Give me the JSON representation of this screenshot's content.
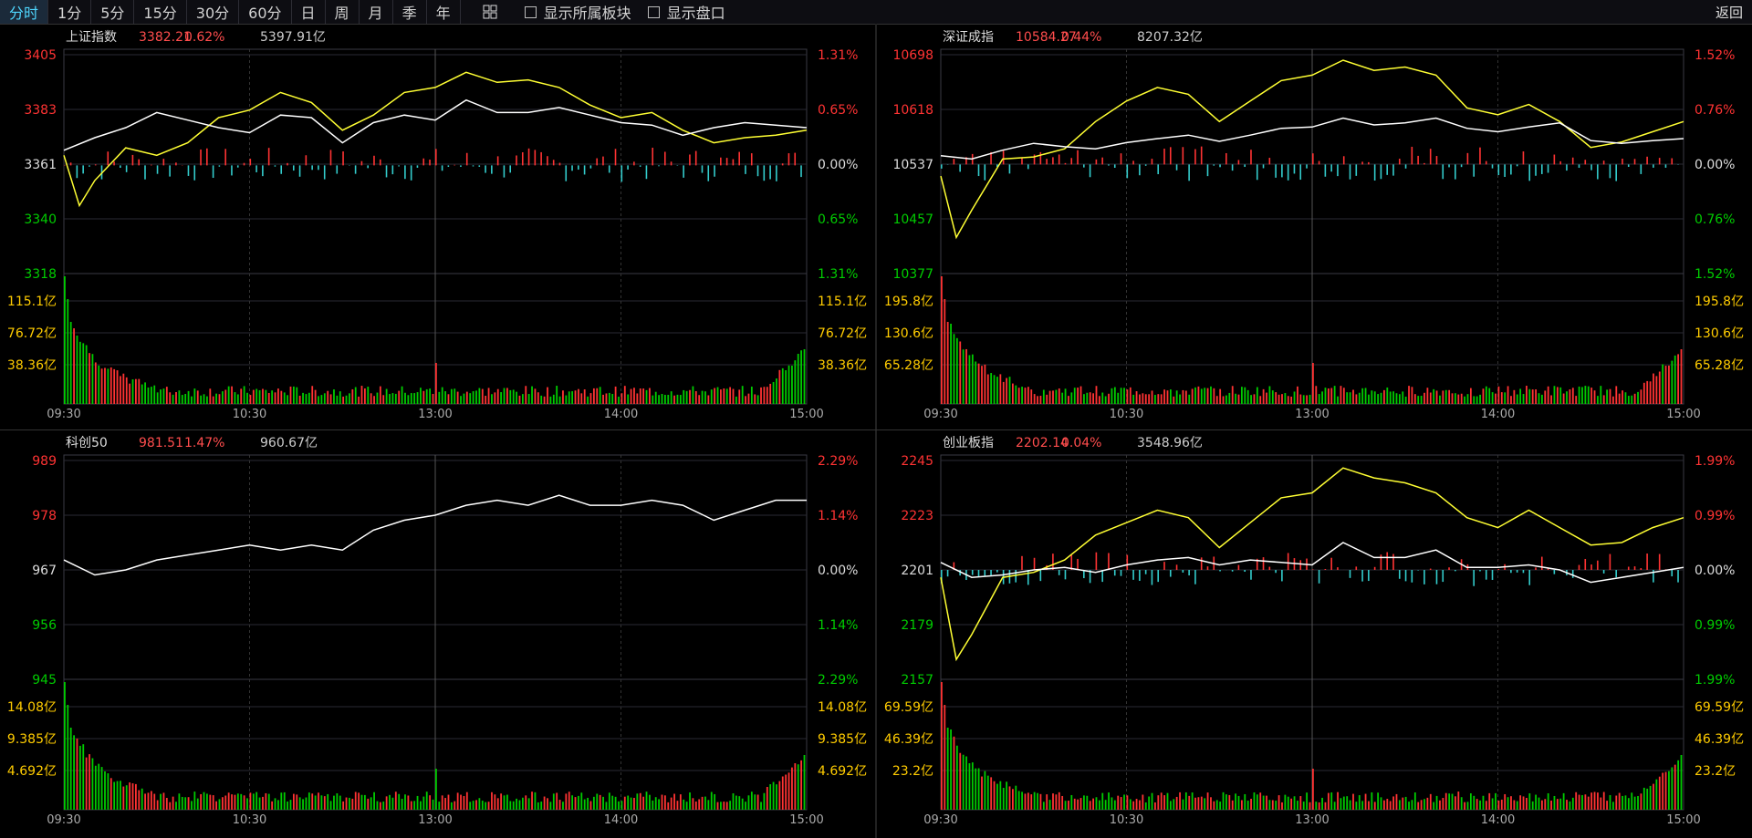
{
  "toolbar": {
    "periods": [
      "分时",
      "1分",
      "5分",
      "15分",
      "30分",
      "60分",
      "日",
      "周",
      "月",
      "季",
      "年"
    ],
    "active_period": "分时",
    "layout_icon": "grid-icon",
    "checkbox_sectors": "显示所属板块",
    "checkbox_orderbook": "显示盘口",
    "back": "返回"
  },
  "colors": {
    "up": "#ff3333",
    "down": "#00cc00",
    "white_line": "#ffffff",
    "yellow_line": "#ffff33",
    "grid": "#2a2a33",
    "vol_label": "#ffcc00",
    "neg_bar": "#33cccc"
  },
  "chart_data": [
    {
      "type": "line",
      "name": "上证指数",
      "price": "3382.21",
      "pct": "0.62%",
      "amount": "5397.91亿",
      "price_ticks": [
        "3405",
        "3383",
        "3361",
        "3340",
        "3318"
      ],
      "pct_ticks": [
        "1.31%",
        "0.65%",
        "0.00%",
        "0.65%",
        "1.31%"
      ],
      "vol_ticks": [
        "115.1亿",
        "76.72亿",
        "38.36亿"
      ],
      "time_ticks": [
        "09:30",
        "10:30",
        "13:00",
        "14:00",
        "15:00"
      ],
      "prev_close": 3361,
      "ylim": [
        3318,
        3405
      ],
      "white": [
        [
          0,
          3367
        ],
        [
          10,
          3372
        ],
        [
          20,
          3376
        ],
        [
          30,
          3382
        ],
        [
          40,
          3379
        ],
        [
          50,
          3376
        ],
        [
          60,
          3374
        ],
        [
          70,
          3381
        ],
        [
          80,
          3380
        ],
        [
          90,
          3370
        ],
        [
          100,
          3378
        ],
        [
          110,
          3381
        ],
        [
          120,
          3379
        ],
        [
          130,
          3387
        ],
        [
          140,
          3382
        ],
        [
          150,
          3382
        ],
        [
          160,
          3384
        ],
        [
          170,
          3381
        ],
        [
          180,
          3378
        ],
        [
          190,
          3377
        ],
        [
          200,
          3373
        ],
        [
          210,
          3376
        ],
        [
          220,
          3378
        ],
        [
          230,
          3377
        ],
        [
          240,
          3376
        ]
      ],
      "yellow": [
        [
          0,
          3365
        ],
        [
          5,
          3345
        ],
        [
          10,
          3355
        ],
        [
          20,
          3368
        ],
        [
          30,
          3365
        ],
        [
          40,
          3370
        ],
        [
          50,
          3380
        ],
        [
          60,
          3383
        ],
        [
          70,
          3390
        ],
        [
          80,
          3386
        ],
        [
          90,
          3375
        ],
        [
          100,
          3381
        ],
        [
          110,
          3390
        ],
        [
          120,
          3392
        ],
        [
          130,
          3398
        ],
        [
          140,
          3394
        ],
        [
          150,
          3395
        ],
        [
          160,
          3392
        ],
        [
          170,
          3385
        ],
        [
          180,
          3380
        ],
        [
          190,
          3382
        ],
        [
          200,
          3375
        ],
        [
          210,
          3370
        ],
        [
          220,
          3372
        ],
        [
          230,
          3373
        ],
        [
          240,
          3375
        ]
      ]
    },
    {
      "type": "line",
      "name": "深证成指",
      "price": "10584.27",
      "pct": "0.44%",
      "amount": "8207.32亿",
      "price_ticks": [
        "10698",
        "10618",
        "10537",
        "10457",
        "10377"
      ],
      "pct_ticks": [
        "1.52%",
        "0.76%",
        "0.00%",
        "0.76%",
        "1.52%"
      ],
      "vol_ticks": [
        "195.8亿",
        "130.6亿",
        "65.28亿"
      ],
      "time_ticks": [
        "09:30",
        "10:30",
        "13:00",
        "14:00",
        "15:00"
      ],
      "prev_close": 10537,
      "ylim": [
        10377,
        10698
      ],
      "white": [
        [
          0,
          10550
        ],
        [
          10,
          10545
        ],
        [
          20,
          10558
        ],
        [
          30,
          10568
        ],
        [
          40,
          10563
        ],
        [
          50,
          10560
        ],
        [
          60,
          10569
        ],
        [
          70,
          10575
        ],
        [
          80,
          10580
        ],
        [
          90,
          10571
        ],
        [
          100,
          10580
        ],
        [
          110,
          10590
        ],
        [
          120,
          10592
        ],
        [
          130,
          10605
        ],
        [
          140,
          10595
        ],
        [
          150,
          10598
        ],
        [
          160,
          10605
        ],
        [
          170,
          10590
        ],
        [
          180,
          10585
        ],
        [
          190,
          10592
        ],
        [
          200,
          10598
        ],
        [
          210,
          10572
        ],
        [
          220,
          10568
        ],
        [
          230,
          10572
        ],
        [
          240,
          10575
        ]
      ],
      "yellow": [
        [
          0,
          10520
        ],
        [
          5,
          10430
        ],
        [
          10,
          10470
        ],
        [
          20,
          10545
        ],
        [
          30,
          10548
        ],
        [
          40,
          10560
        ],
        [
          50,
          10600
        ],
        [
          60,
          10630
        ],
        [
          70,
          10650
        ],
        [
          80,
          10640
        ],
        [
          90,
          10600
        ],
        [
          100,
          10630
        ],
        [
          110,
          10660
        ],
        [
          120,
          10668
        ],
        [
          130,
          10690
        ],
        [
          140,
          10675
        ],
        [
          150,
          10680
        ],
        [
          160,
          10668
        ],
        [
          170,
          10620
        ],
        [
          180,
          10610
        ],
        [
          190,
          10625
        ],
        [
          200,
          10600
        ],
        [
          210,
          10562
        ],
        [
          220,
          10570
        ],
        [
          230,
          10585
        ],
        [
          240,
          10600
        ]
      ]
    },
    {
      "type": "line",
      "name": "科创50",
      "price": "981.51",
      "pct": "1.47%",
      "amount": "960.67亿",
      "price_ticks": [
        "989",
        "978",
        "967",
        "956",
        "945"
      ],
      "pct_ticks": [
        "2.29%",
        "1.14%",
        "0.00%",
        "1.14%",
        "2.29%"
      ],
      "vol_ticks": [
        "14.08亿",
        "9.385亿",
        "4.692亿"
      ],
      "time_ticks": [
        "09:30",
        "10:30",
        "13:00",
        "14:00",
        "15:00"
      ],
      "prev_close": 967,
      "ylim": [
        945,
        989
      ],
      "white": [
        [
          0,
          969
        ],
        [
          10,
          966
        ],
        [
          20,
          967
        ],
        [
          30,
          969
        ],
        [
          40,
          970
        ],
        [
          50,
          971
        ],
        [
          60,
          972
        ],
        [
          70,
          971
        ],
        [
          80,
          972
        ],
        [
          90,
          971
        ],
        [
          100,
          975
        ],
        [
          110,
          977
        ],
        [
          120,
          978
        ],
        [
          130,
          980
        ],
        [
          140,
          981
        ],
        [
          150,
          980
        ],
        [
          160,
          982
        ],
        [
          170,
          980
        ],
        [
          180,
          980
        ],
        [
          190,
          981
        ],
        [
          200,
          980
        ],
        [
          210,
          977
        ],
        [
          220,
          979
        ],
        [
          230,
          981
        ],
        [
          240,
          981
        ]
      ]
    },
    {
      "type": "line",
      "name": "创业板指",
      "price": "2202.14",
      "pct": "0.04%",
      "amount": "3548.96亿",
      "price_ticks": [
        "2245",
        "2223",
        "2201",
        "2179",
        "2157"
      ],
      "pct_ticks": [
        "1.99%",
        "0.99%",
        "0.00%",
        "0.99%",
        "1.99%"
      ],
      "vol_ticks": [
        "69.59亿",
        "46.39亿",
        "23.2亿"
      ],
      "time_ticks": [
        "09:30",
        "10:30",
        "13:00",
        "14:00",
        "15:00"
      ],
      "prev_close": 2201,
      "ylim": [
        2157,
        2245
      ],
      "white": [
        [
          0,
          2204
        ],
        [
          10,
          2198
        ],
        [
          20,
          2199
        ],
        [
          30,
          2201
        ],
        [
          40,
          2202
        ],
        [
          50,
          2200
        ],
        [
          60,
          2203
        ],
        [
          70,
          2205
        ],
        [
          80,
          2206
        ],
        [
          90,
          2203
        ],
        [
          100,
          2205
        ],
        [
          110,
          2204
        ],
        [
          120,
          2203
        ],
        [
          130,
          2212
        ],
        [
          140,
          2206
        ],
        [
          150,
          2206
        ],
        [
          160,
          2209
        ],
        [
          170,
          2202
        ],
        [
          180,
          2202
        ],
        [
          190,
          2203
        ],
        [
          200,
          2201
        ],
        [
          210,
          2196
        ],
        [
          220,
          2198
        ],
        [
          230,
          2200
        ],
        [
          240,
          2202
        ]
      ],
      "yellow": [
        [
          0,
          2198
        ],
        [
          5,
          2165
        ],
        [
          10,
          2175
        ],
        [
          20,
          2198
        ],
        [
          30,
          2200
        ],
        [
          40,
          2205
        ],
        [
          50,
          2215
        ],
        [
          60,
          2220
        ],
        [
          70,
          2225
        ],
        [
          80,
          2222
        ],
        [
          90,
          2210
        ],
        [
          100,
          2220
        ],
        [
          110,
          2230
        ],
        [
          120,
          2232
        ],
        [
          130,
          2242
        ],
        [
          140,
          2238
        ],
        [
          150,
          2236
        ],
        [
          160,
          2232
        ],
        [
          170,
          2222
        ],
        [
          180,
          2218
        ],
        [
          190,
          2225
        ],
        [
          200,
          2218
        ],
        [
          210,
          2211
        ],
        [
          220,
          2212
        ],
        [
          230,
          2218
        ],
        [
          240,
          2222
        ]
      ]
    }
  ]
}
